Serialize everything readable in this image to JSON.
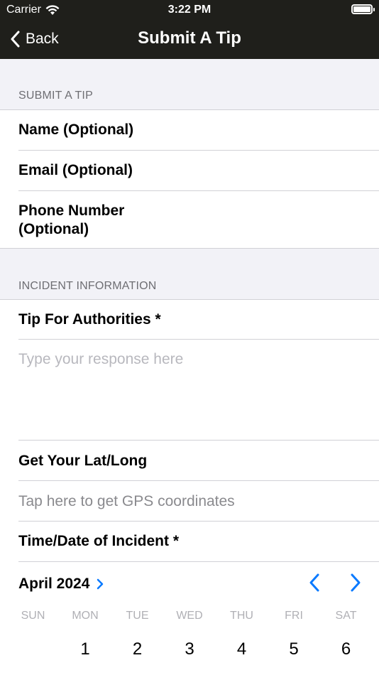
{
  "status_bar": {
    "carrier": "Carrier",
    "time": "3:22 PM",
    "icons": [
      "wifi-icon",
      "battery-icon"
    ]
  },
  "navbar": {
    "back_label": "Back",
    "title": "Submit A Tip"
  },
  "sections": {
    "submit": {
      "header": "SUBMIT A TIP",
      "fields": {
        "name": "Name (Optional)",
        "email": "Email (Optional)",
        "phone_line1": "Phone Number",
        "phone_line2": "(Optional)"
      }
    },
    "incident": {
      "header": "INCIDENT INFORMATION",
      "tip_label": "Tip For Authorities *",
      "tip_placeholder": "Type your response here",
      "latlong_label": "Get Your Lat/Long",
      "gps_text": "Tap here to get GPS coordinates",
      "time_label": "Time/Date of Incident *"
    }
  },
  "calendar": {
    "month_label": "April 2024",
    "weekdays": [
      "SUN",
      "MON",
      "TUE",
      "WED",
      "THU",
      "FRI",
      "SAT"
    ],
    "first_row": [
      "",
      "1",
      "2",
      "3",
      "4",
      "5",
      "6"
    ]
  },
  "colors": {
    "navbar": "#1f1f1b",
    "accent": "#0a7aff",
    "section_bg": "#f2f2f7"
  }
}
